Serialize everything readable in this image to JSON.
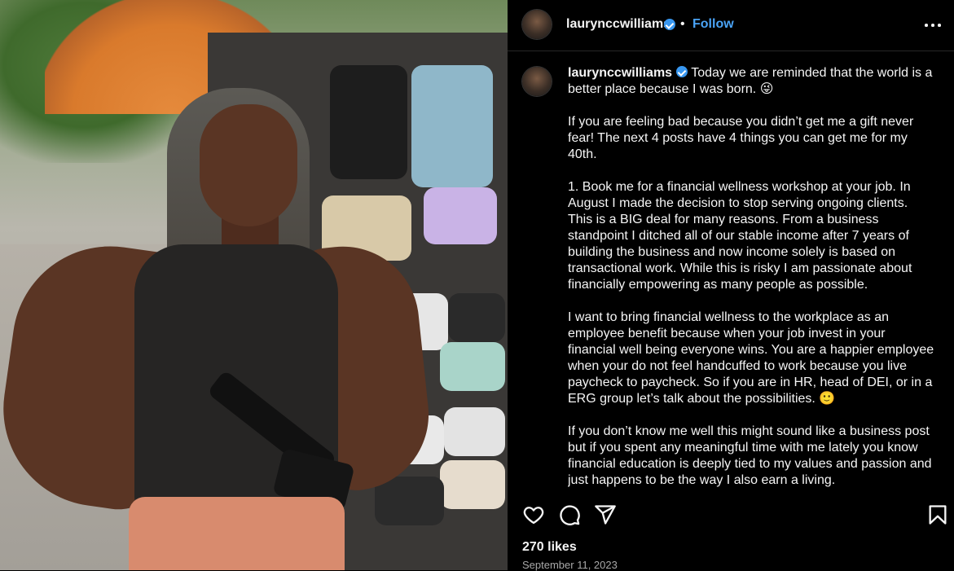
{
  "post": {
    "username": "laurynccwilliams",
    "follow_label": "Follow",
    "separator": "•",
    "caption_user": "laurynccwilliams",
    "caption_first_line": " Today we are reminded that the world is a better place because I was born. 😜",
    "caption_paragraphs": [
      "If you are feeling bad because you didn’t get me a gift never fear! The next 4 posts have 4 things you can get me for my 40th.",
      "1. Book me for a financial wellness workshop at your job. In August I made the decision to stop serving ongoing clients. This is a BIG deal for many reasons. From a business standpoint I ditched all of our stable income after 7 years of building the business and now income solely is based on transactional work. While this is risky I am passionate about financially empowering as many people as possible.",
      "I want to bring financial wellness to the workplace as an employee benefit because when your job invest in your financial well being everyone wins. You are a happier employee when your do not feel handcuffed to work because you live paycheck to paycheck. So if you are in HR, head of DEI, or in a ERG group let’s talk about the possibilities. 🙂",
      "If you don’t know me well this might sound like a business post but if you spent any meaningful time with me lately you know financial education is deeply tied to my values and passion and just happens to be the way I also earn a living."
    ],
    "likes": "270 likes",
    "date": "September 11, 2023"
  },
  "icons": {
    "verified": "verified-badge-icon",
    "more": "more-options-icon",
    "like": "heart-icon",
    "comment": "comment-icon",
    "share": "paper-plane-icon",
    "save": "bookmark-icon"
  },
  "colors": {
    "background": "#000000",
    "text": "#f5f5f5",
    "accent": "#4aa3f5",
    "verified": "#3897f0",
    "muted": "#a8a8a8"
  }
}
